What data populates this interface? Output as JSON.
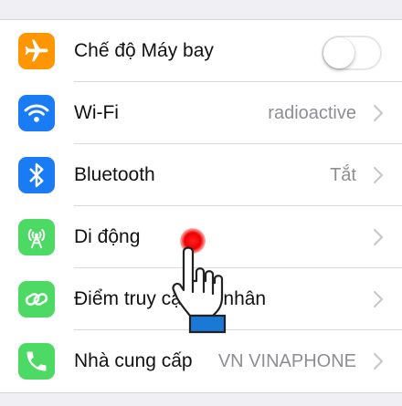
{
  "colors": {
    "airplane": "#ff9500",
    "wifi": "#1a7cf5",
    "bluetooth": "#1a7cf5",
    "cellular": "#4cd964",
    "hotspot": "#4cd964",
    "carrier": "#4cd964",
    "background": "#efeff4"
  },
  "settings": {
    "airplane": {
      "label": "Chế độ Máy bay",
      "icon": "airplane-icon",
      "toggle_on": false
    },
    "wifi": {
      "label": "Wi-Fi",
      "value": "radioactive",
      "icon": "wifi-icon"
    },
    "bluetooth": {
      "label": "Bluetooth",
      "value": "Tắt",
      "icon": "bluetooth-icon"
    },
    "cellular": {
      "label": "Di động",
      "icon": "cellular-antenna-icon"
    },
    "hotspot": {
      "label": "Điểm truy cập cá nhân",
      "icon": "hotspot-link-icon"
    },
    "carrier": {
      "label": "Nhà cung cấp",
      "value": "VN VINAPHONE",
      "icon": "phone-icon"
    }
  },
  "overlay": {
    "tap_indicator": "pointing-hand-icon"
  }
}
